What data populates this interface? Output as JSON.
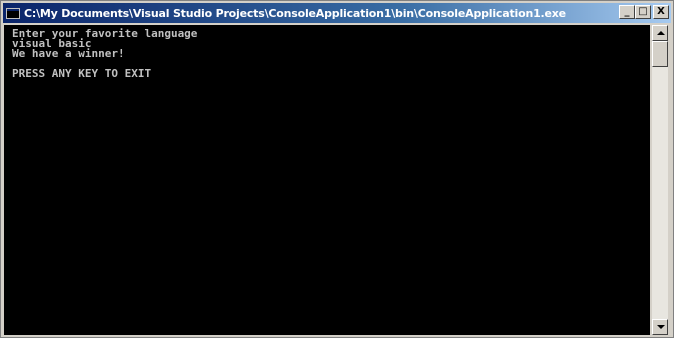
{
  "window": {
    "title": "C:\\My Documents\\Visual Studio Projects\\ConsoleApplication1\\bin\\ConsoleApplication1.exe",
    "minimize_label": "_",
    "maximize_label": "□",
    "close_label": "X"
  },
  "console": {
    "lines": [
      "Enter your favorite language",
      "visual basic",
      "We have a winner!",
      "",
      "PRESS ANY KEY TO EXIT"
    ]
  },
  "colors": {
    "console_bg": "#000000",
    "console_fg": "#c0c0c0",
    "titlebar_start": "#0a246a",
    "titlebar_end": "#a6caf0"
  }
}
